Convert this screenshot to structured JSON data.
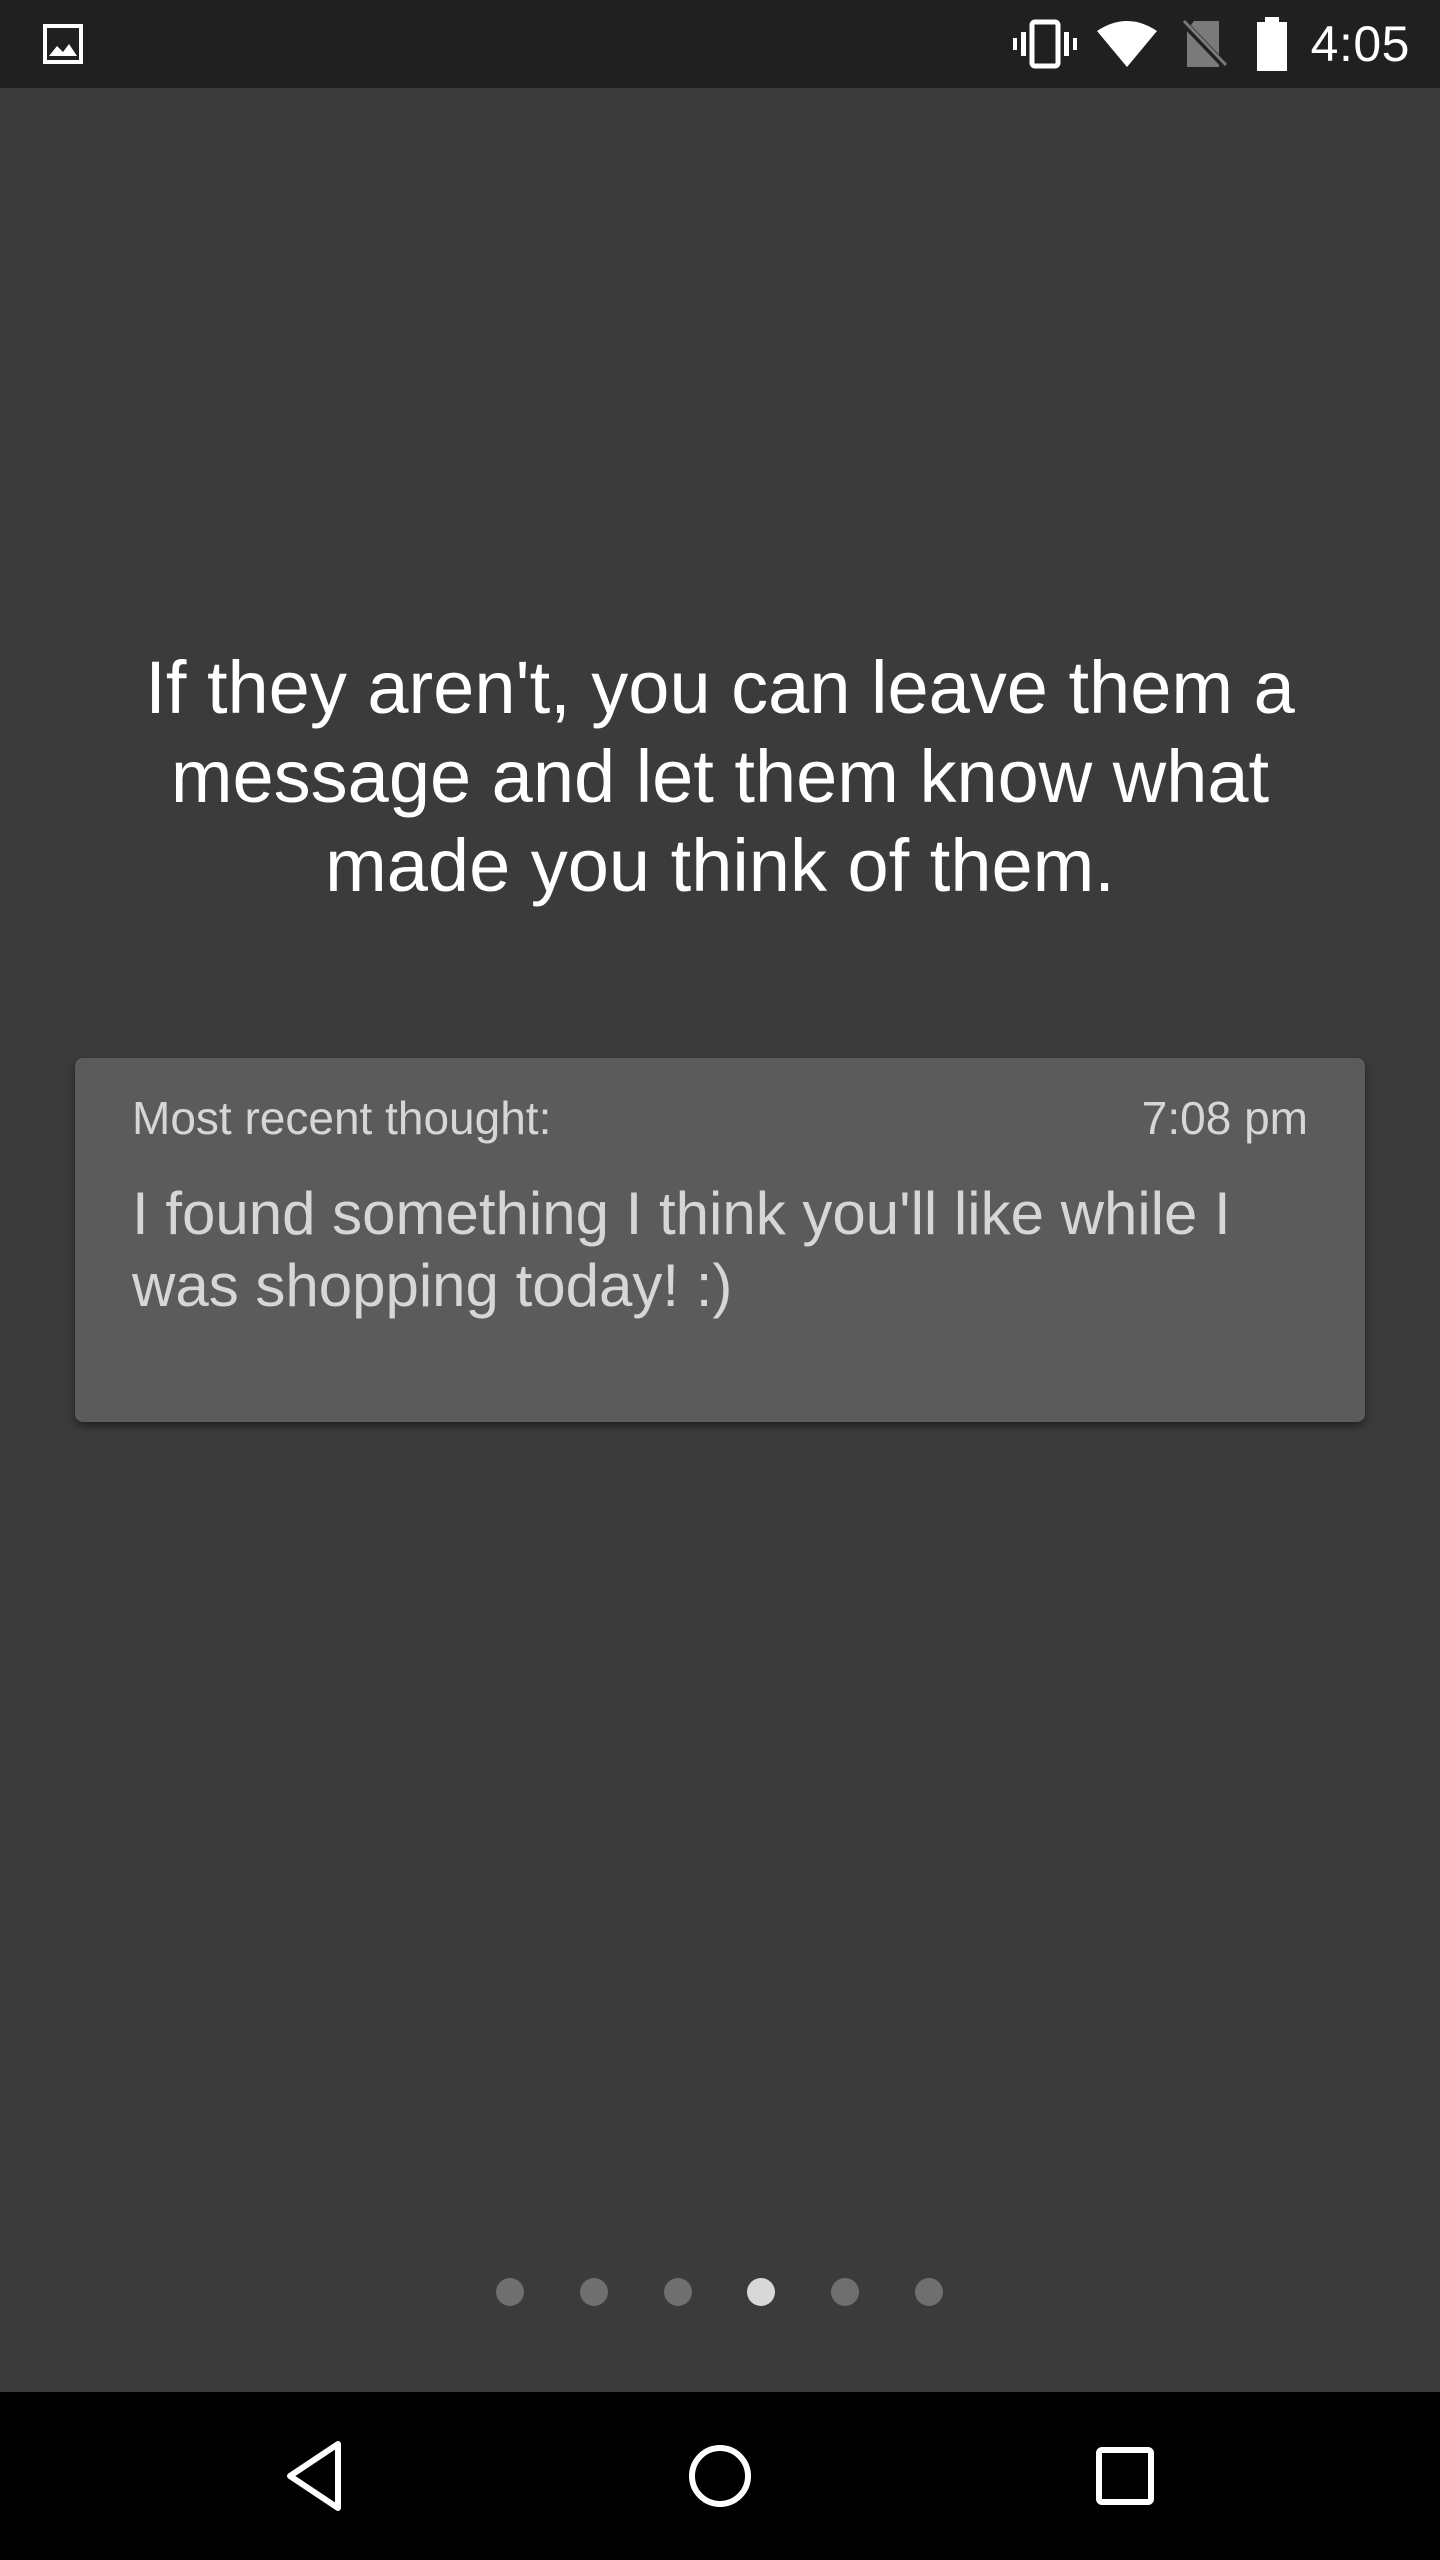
{
  "status_bar": {
    "time": "4:05",
    "icons": {
      "notification": "image-notification-icon",
      "vibrate": "vibrate-icon",
      "wifi": "wifi-icon",
      "sim": "no-sim-icon",
      "battery": "battery-icon"
    }
  },
  "main": {
    "headline": "If they aren't, you can leave them a message and let them know what made you think of them.",
    "card": {
      "label": "Most recent thought:",
      "time": "7:08 pm",
      "message": "I found something I think you'll like while I was shopping today! :)"
    }
  },
  "pager": {
    "count": 6,
    "active_index": 3
  },
  "nav_bar": {
    "icons": [
      "back-icon",
      "home-icon",
      "recents-icon"
    ]
  },
  "colors": {
    "background": "#3b3b3b",
    "status_bar": "#202020",
    "card": "#5b5b5b",
    "card_text": "#d6d6d6",
    "dot_inactive": "#6f6f6f",
    "dot_active": "#d8d8d8",
    "nav_bar": "#000000"
  }
}
